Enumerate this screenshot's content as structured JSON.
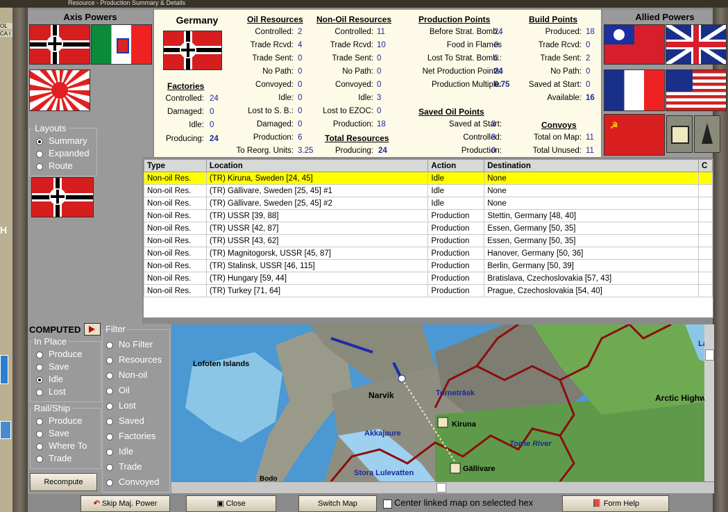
{
  "window": {
    "title": "Resource - Production Summary & Details"
  },
  "left_strip": {
    "tags": [
      "OL",
      "CA I",
      "H"
    ]
  },
  "axis": {
    "title": "Axis Powers"
  },
  "allied": {
    "title": "Allied Powers"
  },
  "country": {
    "name": "Germany"
  },
  "factories": {
    "title": "Factories",
    "rows": [
      {
        "label": "Controlled:",
        "value": "24"
      },
      {
        "label": "Damaged:",
        "value": "0"
      },
      {
        "label": "Idle:",
        "value": "0"
      },
      {
        "label": "Producing:",
        "value": "24"
      }
    ]
  },
  "oil": {
    "title": "Oil Resources",
    "rows": [
      {
        "label": "Controlled:",
        "value": "2"
      },
      {
        "label": "Trade Rcvd:",
        "value": "4"
      },
      {
        "label": "Trade Sent:",
        "value": "0"
      },
      {
        "label": "No Path:",
        "value": "0"
      },
      {
        "label": "Convoyed:",
        "value": "0"
      },
      {
        "label": "Idle:",
        "value": "0"
      },
      {
        "label": "Lost to S. B.:",
        "value": "0"
      },
      {
        "label": "Damaged:",
        "value": "0"
      },
      {
        "label": "Production:",
        "value": "6"
      },
      {
        "label": "To Reorg. Units:",
        "value": "3.25"
      }
    ]
  },
  "nonoil": {
    "title": "Non-Oil Resources",
    "rows": [
      {
        "label": "Controlled:",
        "value": "11"
      },
      {
        "label": "Trade Rcvd:",
        "value": "10"
      },
      {
        "label": "Trade Sent:",
        "value": "0"
      },
      {
        "label": "No Path:",
        "value": "0"
      },
      {
        "label": "Convoyed:",
        "value": "0"
      },
      {
        "label": "Idle:",
        "value": "3"
      },
      {
        "label": "Lost to EZOC:",
        "value": "0"
      },
      {
        "label": "Production:",
        "value": "18"
      }
    ]
  },
  "total": {
    "title": "Total Resources",
    "label": "Producing:",
    "value": "24"
  },
  "pp": {
    "title": "Production Points",
    "rows": [
      {
        "label": "Before Strat. Bomb.:",
        "value": "24"
      },
      {
        "label": "Food in Flames",
        "value": "0"
      },
      {
        "label": "Lost To Strat. Bomb.:",
        "value": "0"
      },
      {
        "label": "Net Production Points:",
        "value": "24"
      },
      {
        "label": "Production Multiple:",
        "value": "0.75"
      }
    ]
  },
  "saved_oil": {
    "title": "Saved Oil Points",
    "rows": [
      {
        "label": "Saved at Start:",
        "value": "3"
      },
      {
        "label": "Controlled:",
        "value": "3"
      },
      {
        "label": "Production:",
        "value": "0"
      }
    ]
  },
  "bp": {
    "title": "Build Points",
    "rows": [
      {
        "label": "Produced:",
        "value": "18"
      },
      {
        "label": "Trade Rcvd:",
        "value": "0"
      },
      {
        "label": "Trade Sent:",
        "value": "2"
      },
      {
        "label": "No Path:",
        "value": "0"
      },
      {
        "label": "Saved at Start:",
        "value": "0"
      },
      {
        "label": "Available:",
        "value": "16"
      }
    ]
  },
  "convoys": {
    "title": "Convoys",
    "rows": [
      {
        "label": "Total on Map:",
        "value": "11"
      },
      {
        "label": "Total Unused:",
        "value": "11"
      }
    ]
  },
  "layouts": {
    "title": "Layouts",
    "options": [
      "Summary",
      "Expanded",
      "Route"
    ],
    "selected": "Summary"
  },
  "table": {
    "headers": [
      "Type",
      "Location",
      "Action",
      "Destination",
      "C"
    ],
    "rows": [
      [
        "Non-oil Res.",
        "(TR) Kiruna, Sweden [24, 45]",
        "Idle",
        "None"
      ],
      [
        "Non-oil Res.",
        "(TR) Gällivare, Sweden [25, 45] #1",
        "Idle",
        "None"
      ],
      [
        "Non-oil Res.",
        "(TR) Gällivare, Sweden [25, 45] #2",
        "Idle",
        "None"
      ],
      [
        "Non-oil Res.",
        "(TR) USSR [39, 88]",
        "Production",
        "Stettin, Germany [48, 40]"
      ],
      [
        "Non-oil Res.",
        "(TR) USSR [42, 87]",
        "Production",
        "Essen, Germany [50, 35]"
      ],
      [
        "Non-oil Res.",
        "(TR) USSR [43, 62]",
        "Production",
        "Essen, Germany [50, 35]"
      ],
      [
        "Non-oil Res.",
        "(TR) Magnitogorsk, USSR [45, 87]",
        "Production",
        "Hanover, Germany [50, 36]"
      ],
      [
        "Non-oil Res.",
        "(TR) Stalinsk, USSR [46, 115]",
        "Production",
        "Berlin, Germany [50, 39]"
      ],
      [
        "Non-oil Res.",
        "(TR) Hungary [59, 44]",
        "Production",
        "Bratislava, Czechoslovakia [57, 43]"
      ],
      [
        "Non-oil Res.",
        "(TR) Turkey [71, 64]",
        "Production",
        "Prague, Czechoslovakia [54, 40]"
      ]
    ]
  },
  "computed": {
    "label": "COMPUTED"
  },
  "in_place": {
    "title": "In Place",
    "options": [
      "Produce",
      "Save",
      "Idle",
      "Lost"
    ],
    "selected": "Idle"
  },
  "rail_ship": {
    "title": "Rail/Ship",
    "options": [
      "Produce",
      "Save",
      "Where To",
      "Trade"
    ]
  },
  "filter": {
    "title": "Filter",
    "options": [
      "No Filter",
      "Resources",
      "Non-oil",
      "Oil",
      "Lost",
      "Saved",
      "Factories",
      "Idle",
      "Trade",
      "Convoyed"
    ]
  },
  "recompute": {
    "label": "Recompute"
  },
  "map_labels": [
    "Lofoten Islands",
    "Narvik",
    "Torneträsk",
    "Kiruna",
    "Akkajaure",
    "Torne River",
    "Gällivare",
    "Stora Lulevatten",
    "Bodo",
    "Arctic Highw",
    "Lak"
  ],
  "bottom": {
    "skip": "Skip Maj. Power",
    "close": "Close",
    "switch": "Switch Map",
    "center": "Center linked map on selected hex",
    "help": "Form Help"
  }
}
